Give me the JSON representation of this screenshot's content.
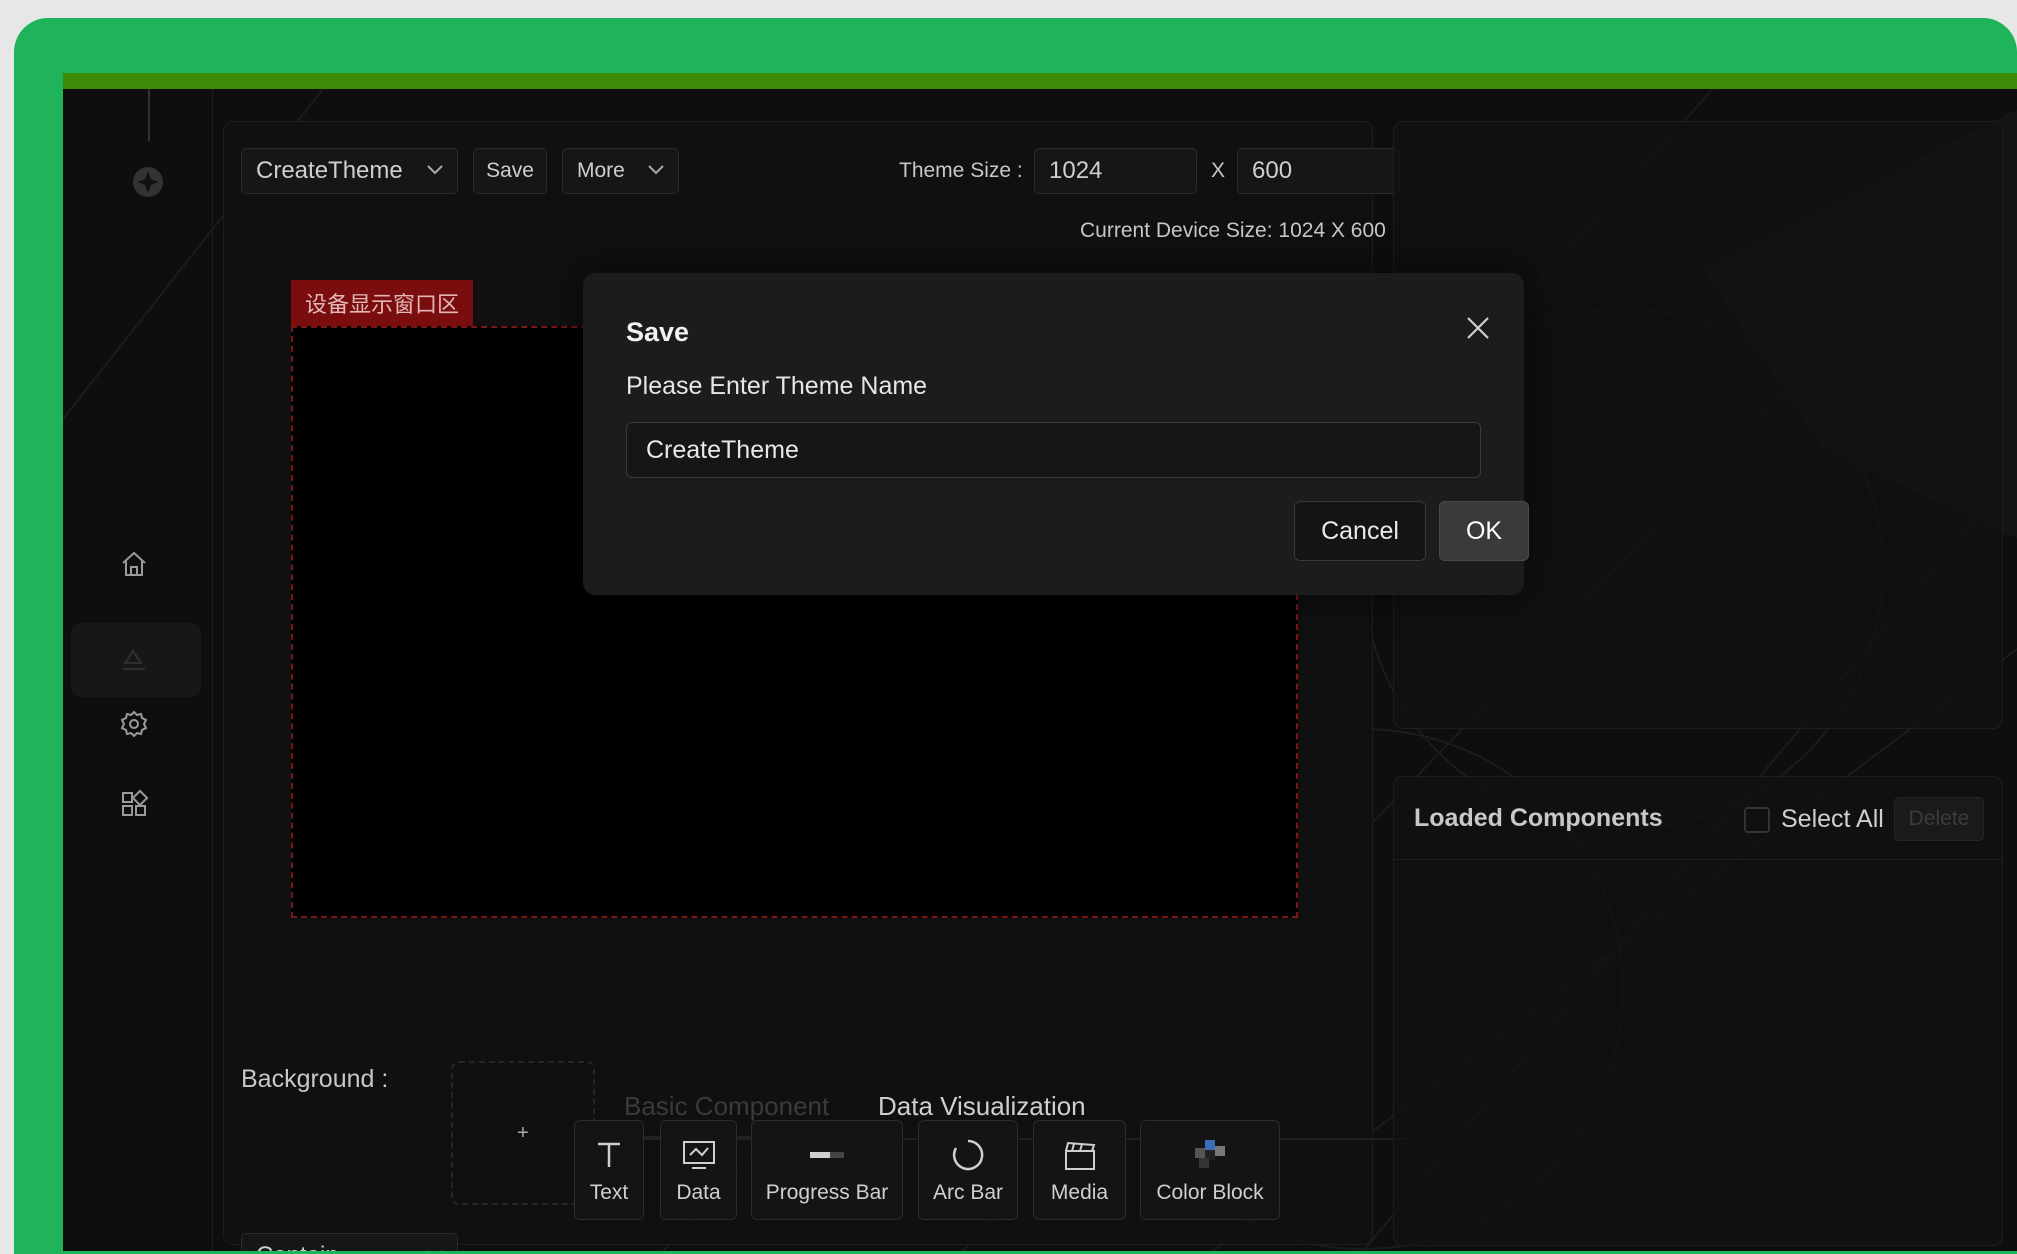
{
  "toolbar": {
    "theme_select": "CreateTheme",
    "save_label": "Save",
    "more_label": "More",
    "theme_size_label": "Theme Size :",
    "width_value": "1024",
    "x_label": "X",
    "height_value": "600",
    "device_size_text": "Current Device Size:  1024 X 600"
  },
  "stage": {
    "tag": "设备显示窗口区"
  },
  "background": {
    "label": "Background :",
    "add_symbol": "+",
    "fit_select": "Contain"
  },
  "palette": {
    "tabs": [
      {
        "label": "Basic Component",
        "active": true
      },
      {
        "label": "Data Visualization",
        "active": false
      }
    ],
    "components": [
      {
        "label": "Text",
        "icon": "text-icon"
      },
      {
        "label": "Data",
        "icon": "chart-icon"
      },
      {
        "label": "Progress Bar",
        "icon": "progress-bar-icon"
      },
      {
        "label": "Arc Bar",
        "icon": "arc-icon"
      },
      {
        "label": "Media",
        "icon": "clapperboard-icon"
      },
      {
        "label": "Color Block",
        "icon": "color-block-icon"
      }
    ]
  },
  "loaded": {
    "title": "Loaded Components",
    "select_all": "Select All",
    "delete_label": "Delete"
  },
  "sidebar": {
    "items": [
      {
        "icon": "logo-icon"
      },
      {
        "icon": "home-icon"
      },
      {
        "icon": "theme-edit-icon",
        "active": true
      },
      {
        "icon": "gear-icon"
      },
      {
        "icon": "apps-icon"
      }
    ]
  },
  "modal": {
    "title": "Save",
    "prompt": "Please Enter Theme Name",
    "input_value": "CreateTheme",
    "cancel_label": "Cancel",
    "ok_label": "OK"
  },
  "colors": {
    "frame_green": "#1fb35a",
    "titlebar_green": "#3d8a07",
    "stage_tag_red": "#7a0d0d"
  }
}
